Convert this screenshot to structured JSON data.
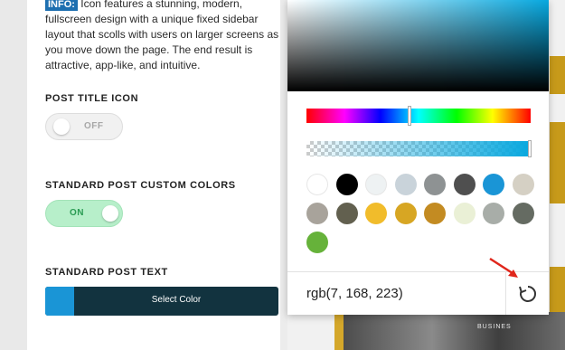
{
  "info": {
    "badge": "INFO:",
    "text": " Icon features a stunning, modern, fullscreen design with a unique fixed sidebar layout that scolls with users on larger screens as you move down the page. The end result is attractive, app-like, and intuitive."
  },
  "settings": {
    "post_title_icon": {
      "label": "POST TITLE ICON",
      "state": "OFF"
    },
    "custom_colors": {
      "label": "STANDARD POST CUSTOM COLORS",
      "state": "ON"
    },
    "post_text": {
      "label": "STANDARD POST TEXT",
      "button": "Select Color",
      "swatch_color": "#1a95d6"
    }
  },
  "picker": {
    "value": "rgb(7, 168, 223)",
    "current_color": "#07a8df",
    "hue_level": 0.46,
    "alpha_level": 1,
    "swatches": [
      "#ffffff",
      "#000000",
      "#eef2f3",
      "#c9d3da",
      "#8e9293",
      "#4f4f4f",
      "#1a95d6",
      "#d5d0c4",
      "#a8a39b",
      "#62604f",
      "#f1bc2b",
      "#d7a623",
      "#c38b22",
      "#eaf0d6",
      "#a8ada8",
      "#656b62",
      "#66b23a"
    ]
  },
  "background": {
    "gold": "#c79a1a",
    "photo_caption": "BUSINES"
  }
}
